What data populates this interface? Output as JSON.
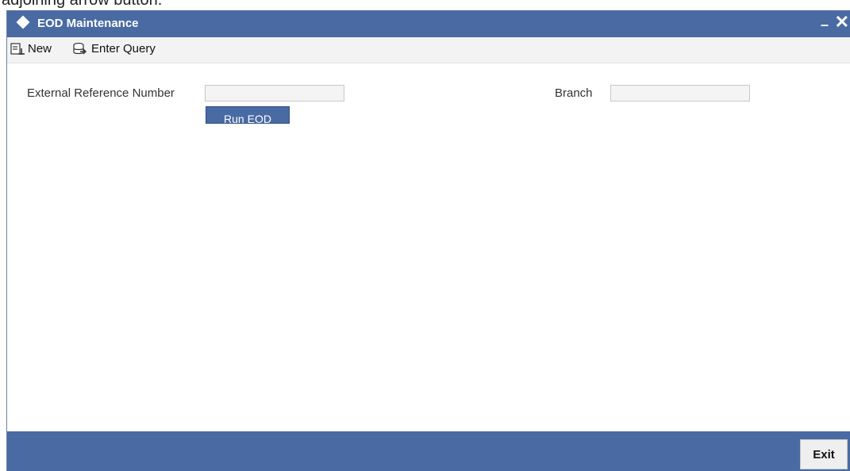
{
  "caption": {
    "text": "adjoining arrow button."
  },
  "window": {
    "title": "EOD Maintenance",
    "minimize_label": "–",
    "close_label": "✕"
  },
  "toolbar": {
    "new_label": "New",
    "enter_query_label": "Enter Query"
  },
  "form": {
    "external_reference_label": "External Reference Number",
    "external_reference_value": "",
    "branch_label": "Branch",
    "branch_value": "",
    "run_eod_label": "Run EOD"
  },
  "footer": {
    "exit_label": "Exit"
  },
  "colors": {
    "accent": "#4a6aa3",
    "toolbar_bg": "#f3f3f3",
    "input_bg": "#f4f4f4"
  }
}
